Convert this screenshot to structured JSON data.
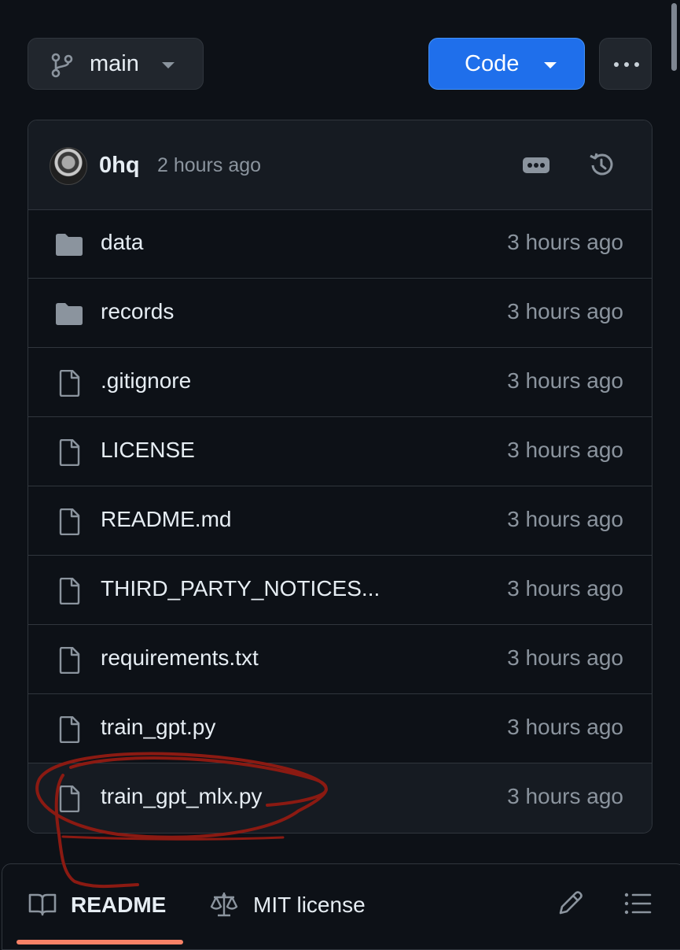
{
  "branch": {
    "name": "main",
    "icon": "git-branch-icon"
  },
  "code_button": {
    "label": "Code",
    "color": "#1f6feb"
  },
  "more_button": {
    "icon": "kebab-horizontal-icon"
  },
  "commit": {
    "author": "0hq",
    "time": "2 hours ago",
    "more_icon": "ellipsis-icon",
    "history_icon": "history-icon"
  },
  "files": [
    {
      "name": "data",
      "type": "folder",
      "time": "3 hours ago"
    },
    {
      "name": "records",
      "type": "folder",
      "time": "3 hours ago"
    },
    {
      "name": ".gitignore",
      "type": "file",
      "time": "3 hours ago"
    },
    {
      "name": "LICENSE",
      "type": "file",
      "time": "3 hours ago"
    },
    {
      "name": "README.md",
      "type": "file",
      "time": "3 hours ago"
    },
    {
      "name": "THIRD_PARTY_NOTICES...",
      "type": "file",
      "time": "3 hours ago"
    },
    {
      "name": "requirements.txt",
      "type": "file",
      "time": "3 hours ago"
    },
    {
      "name": "train_gpt.py",
      "type": "file",
      "time": "3 hours ago"
    },
    {
      "name": "train_gpt_mlx.py",
      "type": "file",
      "time": "3 hours ago"
    }
  ],
  "tabs": {
    "readme": {
      "label": "README",
      "icon": "book-icon"
    },
    "license": {
      "label": "MIT license",
      "icon": "law-icon"
    },
    "edit_icon": "pencil-icon",
    "toc_icon": "list-unordered-icon"
  },
  "colors": {
    "background": "#0d1117",
    "border": "#30363d",
    "muted_text": "#8b949e",
    "tab_underline": "#f78166",
    "annotation_ink": "#8b1a12"
  }
}
